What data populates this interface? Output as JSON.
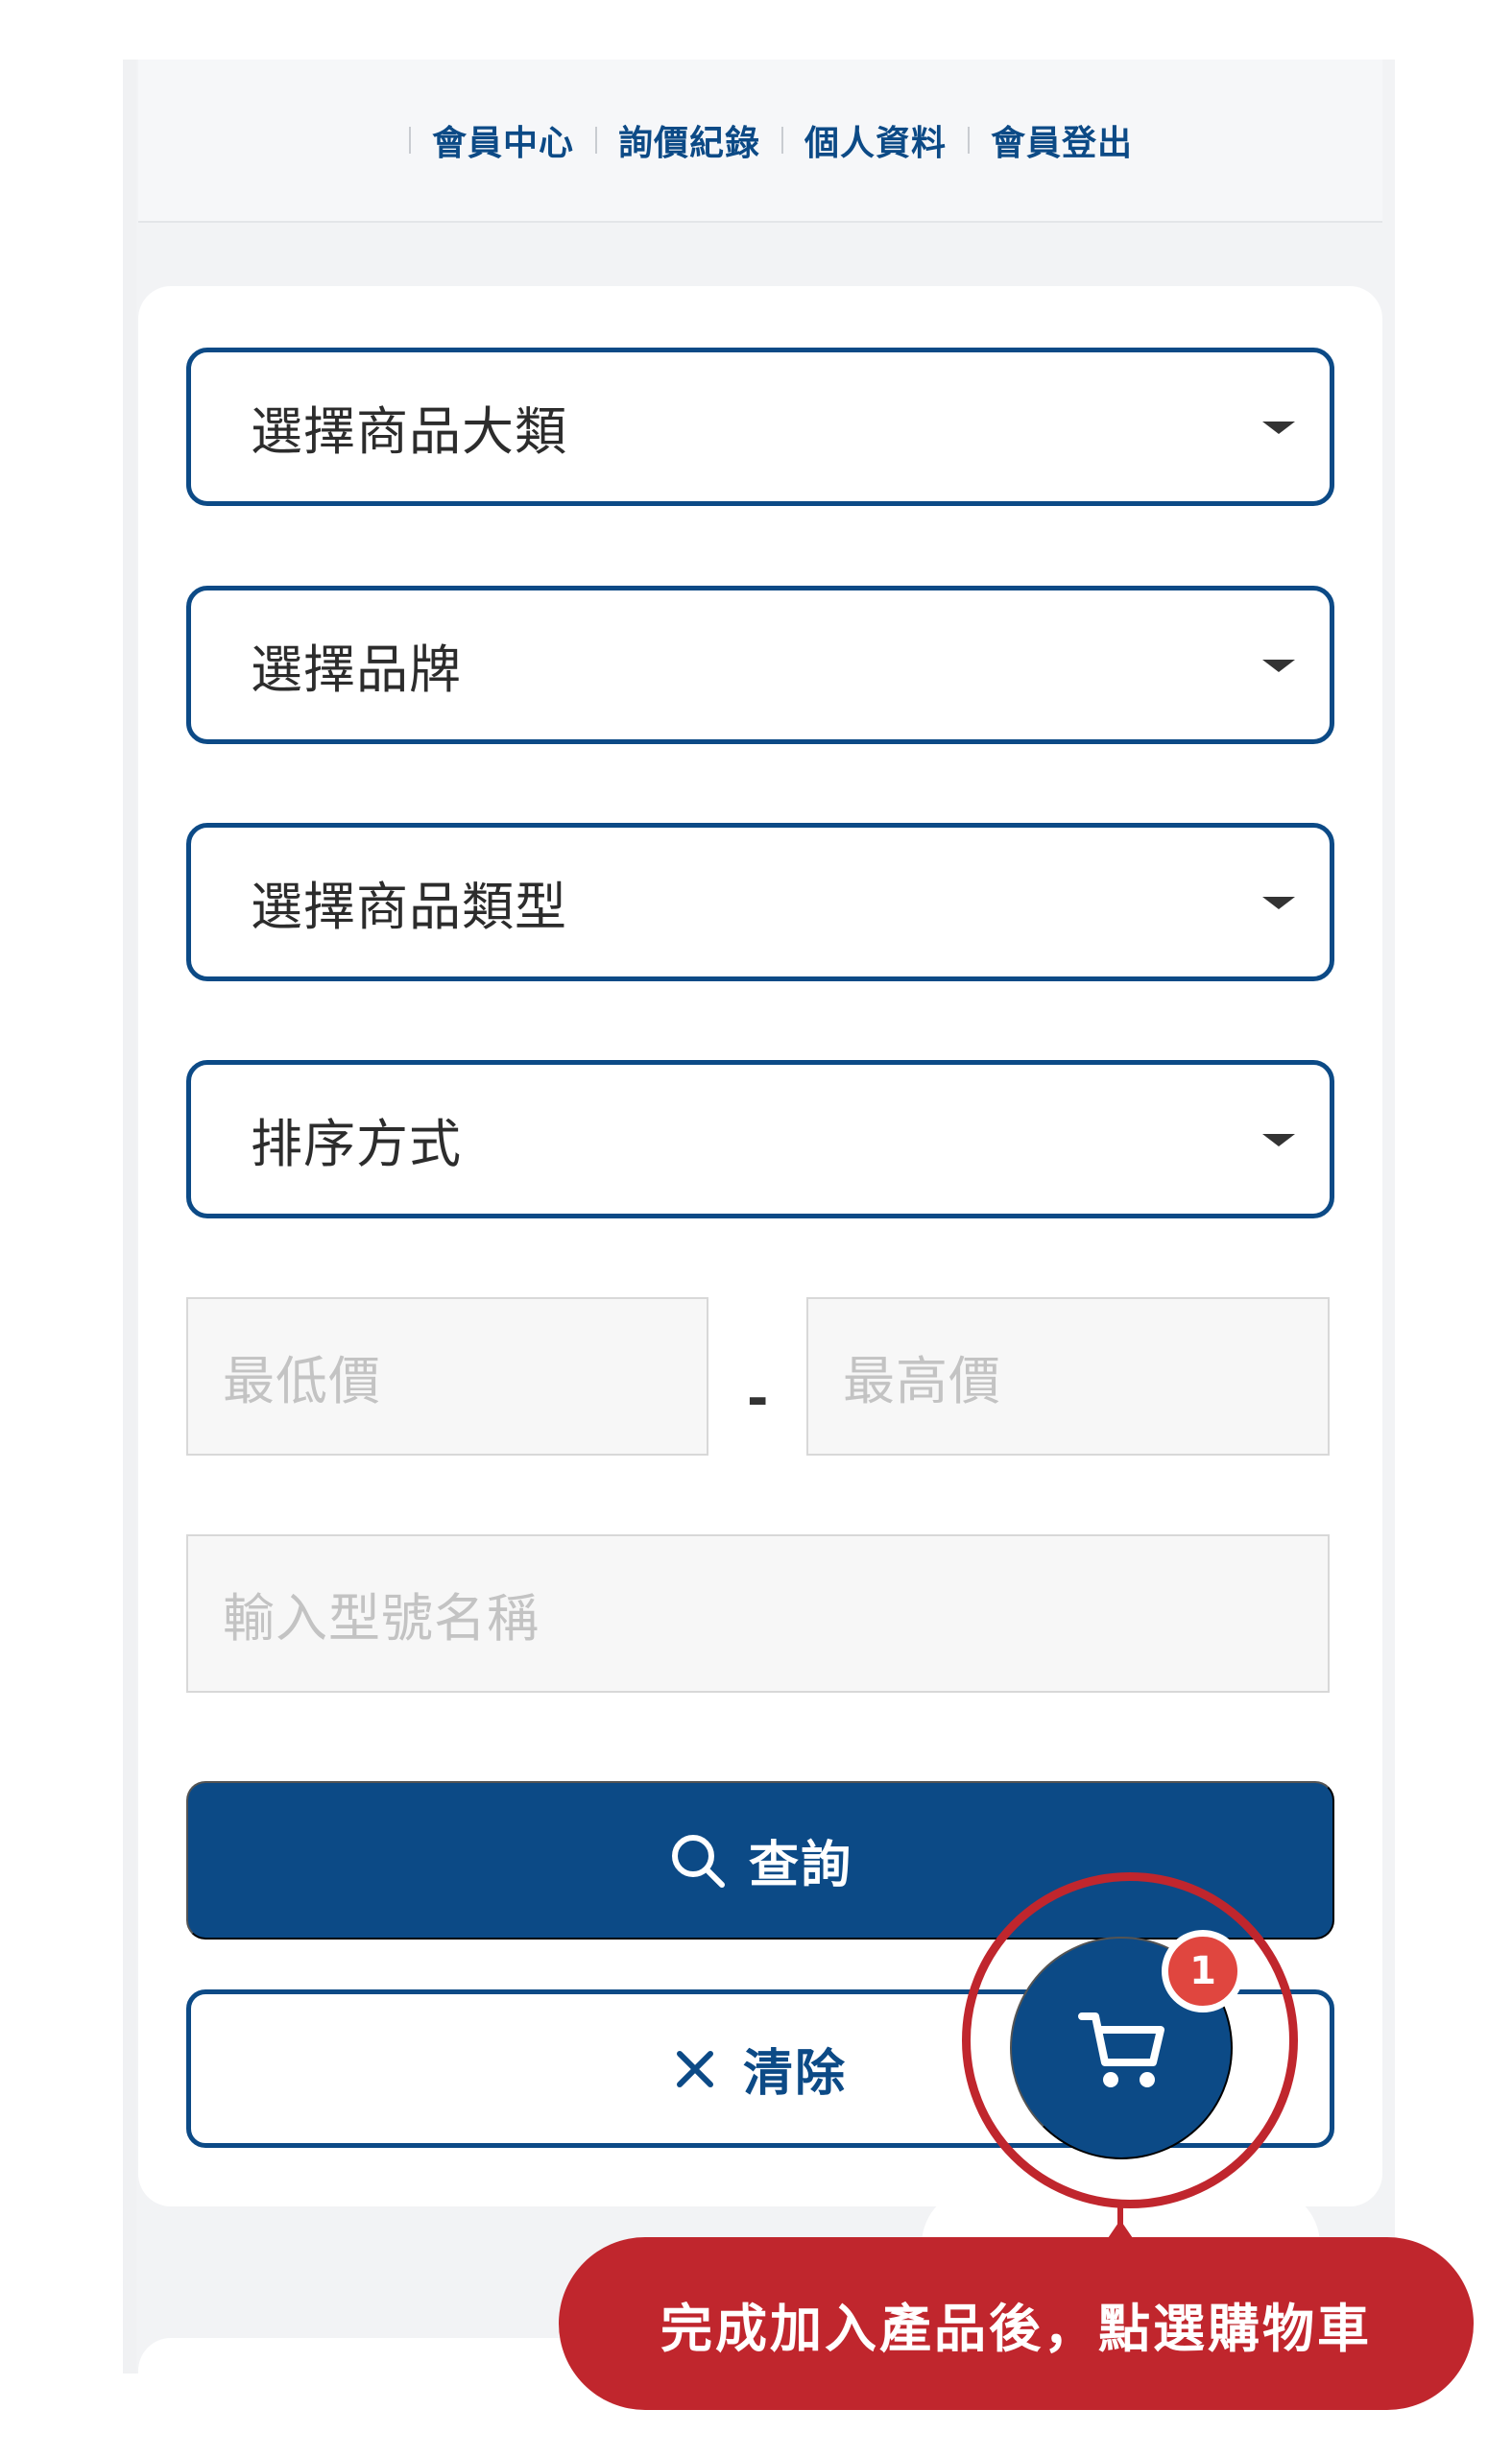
{
  "nav": {
    "links": [
      "會員中心",
      "詢價紀錄",
      "個人資料",
      "會員登出"
    ]
  },
  "filters": {
    "category_select": "選擇商品大類",
    "brand_select": "選擇品牌",
    "type_select": "選擇商品類型",
    "sort_select": "排序方式",
    "min_price_placeholder": "最低價",
    "price_separator": "-",
    "max_price_placeholder": "最高價",
    "model_placeholder": "輸入型號名稱"
  },
  "buttons": {
    "search_label": "查詢",
    "clear_label": "清除"
  },
  "cart": {
    "badge_count": "1"
  },
  "callout": {
    "text": "完成加入產品後，點選購物車"
  },
  "colors": {
    "primary": "#0c4a86",
    "highlight": "#c0262d",
    "badge": "#e0463f"
  }
}
